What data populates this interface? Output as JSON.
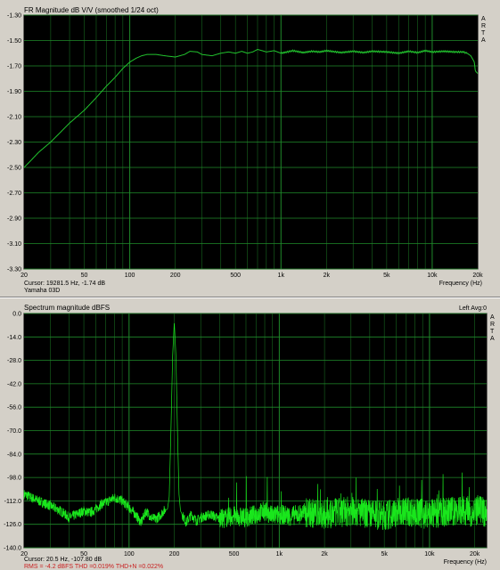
{
  "colors": {
    "background": "#d4d0c8",
    "plot_bg": "#000000",
    "grid": "#1f8a2a",
    "fr_line": "#22c32e",
    "spectrum_line": "#19e61c",
    "stats_text": "#c81e1e"
  },
  "fr_panel": {
    "title": "FR Magnitude dB V/V  (smoothed 1/24 oct)",
    "side_label": [
      "A",
      "R",
      "T",
      "A"
    ],
    "cursor_text": "Cursor:  19281.5 Hz, -1.74 dB",
    "device_text": "Yamaha 03D",
    "xlabel": "Frequency (Hz)"
  },
  "spectrum_panel": {
    "title": "Spectrum magnitude dBFS",
    "right_title": "Left  Avg:0",
    "side_label": [
      "A",
      "R",
      "T",
      "A"
    ],
    "cursor_text": "Cursor:   20.5 Hz, -107.80 dB",
    "stats_text": "RMS =  -4.2 dBFS   THD =0.019%   THD+N =0.022%",
    "xlabel": "Frequency (Hz)"
  },
  "chart_data": [
    {
      "type": "line",
      "title": "FR Magnitude dB V/V  (smoothed 1/24 oct)",
      "xlabel": "Frequency (Hz)",
      "ylabel": "",
      "xscale": "log",
      "xlim": [
        20,
        20000
      ],
      "ylim": [
        -3.3,
        -1.3
      ],
      "y_ticks": [
        "-1.30",
        "-1.50",
        "-1.70",
        "-1.90",
        "-2.10",
        "-2.30",
        "-2.50",
        "-2.70",
        "-2.90",
        "-3.10",
        "-3.30"
      ],
      "x_ticks": [
        "20",
        "50",
        "100",
        "200",
        "500",
        "1k",
        "2k",
        "5k",
        "10k",
        "20k"
      ],
      "grid": true,
      "series": [
        {
          "x": [
            20,
            22,
            25,
            30,
            35,
            40,
            50,
            60,
            70,
            80,
            90,
            100,
            110,
            120,
            130,
            140,
            150,
            170,
            200,
            230,
            250,
            280,
            300,
            350,
            400,
            450,
            500,
            550,
            600,
            650,
            700,
            750,
            800,
            900,
            1000,
            1100,
            1200,
            1400,
            1600,
            1800,
            2000,
            2500,
            3000,
            3500,
            4000,
            5000,
            6000,
            7000,
            8000,
            9000,
            10000,
            12000,
            14000,
            16000,
            17000,
            18000,
            19000,
            19281.5,
            20000
          ],
          "y": [
            -2.5,
            -2.45,
            -2.38,
            -2.3,
            -2.22,
            -2.15,
            -2.05,
            -1.95,
            -1.86,
            -1.79,
            -1.72,
            -1.67,
            -1.64,
            -1.62,
            -1.61,
            -1.61,
            -1.61,
            -1.62,
            -1.63,
            -1.61,
            -1.585,
            -1.59,
            -1.61,
            -1.62,
            -1.6,
            -1.59,
            -1.6,
            -1.585,
            -1.6,
            -1.59,
            -1.57,
            -1.58,
            -1.59,
            -1.58,
            -1.6,
            -1.59,
            -1.58,
            -1.595,
            -1.585,
            -1.59,
            -1.58,
            -1.595,
            -1.585,
            -1.595,
            -1.585,
            -1.59,
            -1.6,
            -1.585,
            -1.595,
            -1.58,
            -1.59,
            -1.585,
            -1.59,
            -1.59,
            -1.6,
            -1.62,
            -1.67,
            -1.74,
            -1.76
          ]
        }
      ]
    },
    {
      "type": "line",
      "title": "Spectrum magnitude dBFS",
      "xlabel": "Frequency (Hz)",
      "ylabel": "",
      "xscale": "log",
      "xlim": [
        20,
        24000
      ],
      "ylim": [
        -140,
        0
      ],
      "y_ticks": [
        "0.0",
        "-14.0",
        "-28.0",
        "-42.0",
        "-56.0",
        "-70.0",
        "-84.0",
        "-98.0",
        "-112.0",
        "-126.0",
        "-140.0"
      ],
      "x_ticks": [
        "20",
        "50",
        "100",
        "200",
        "500",
        "1k",
        "2k",
        "5k",
        "10k",
        "20k"
      ],
      "grid": true,
      "series": [
        {
          "x": [
            20,
            25,
            30,
            35,
            40,
            45,
            50,
            55,
            60,
            65,
            70,
            80,
            90,
            95,
            100,
            110,
            120,
            130,
            140,
            150,
            160,
            170,
            180,
            185,
            190,
            195,
            200,
            205,
            210,
            215,
            220,
            240,
            260,
            280,
            300,
            350,
            400,
            500,
            600,
            700,
            800,
            900,
            1000,
            1200,
            1500,
            2000,
            2500,
            3000,
            4000,
            5000,
            6000,
            7000,
            8000,
            10000,
            12000,
            15000,
            18000,
            20000,
            22000,
            24000
          ],
          "y": [
            -108,
            -112,
            -115,
            -118,
            -122,
            -120,
            -118,
            -119,
            -117,
            -114,
            -113,
            -110,
            -112,
            -114,
            -116,
            -120,
            -125,
            -118,
            -122,
            -123,
            -121,
            -118,
            -117,
            -110,
            -70,
            -25,
            -5,
            -25,
            -70,
            -108,
            -118,
            -125,
            -120,
            -124,
            -122,
            -120,
            -123,
            -121,
            -122,
            -120,
            -118,
            -121,
            -120,
            -121,
            -119,
            -120,
            -119,
            -118,
            -120,
            -121,
            -119,
            -118,
            -119,
            -120,
            -119,
            -118,
            -118,
            -119,
            -118,
            -119
          ]
        }
      ]
    }
  ]
}
